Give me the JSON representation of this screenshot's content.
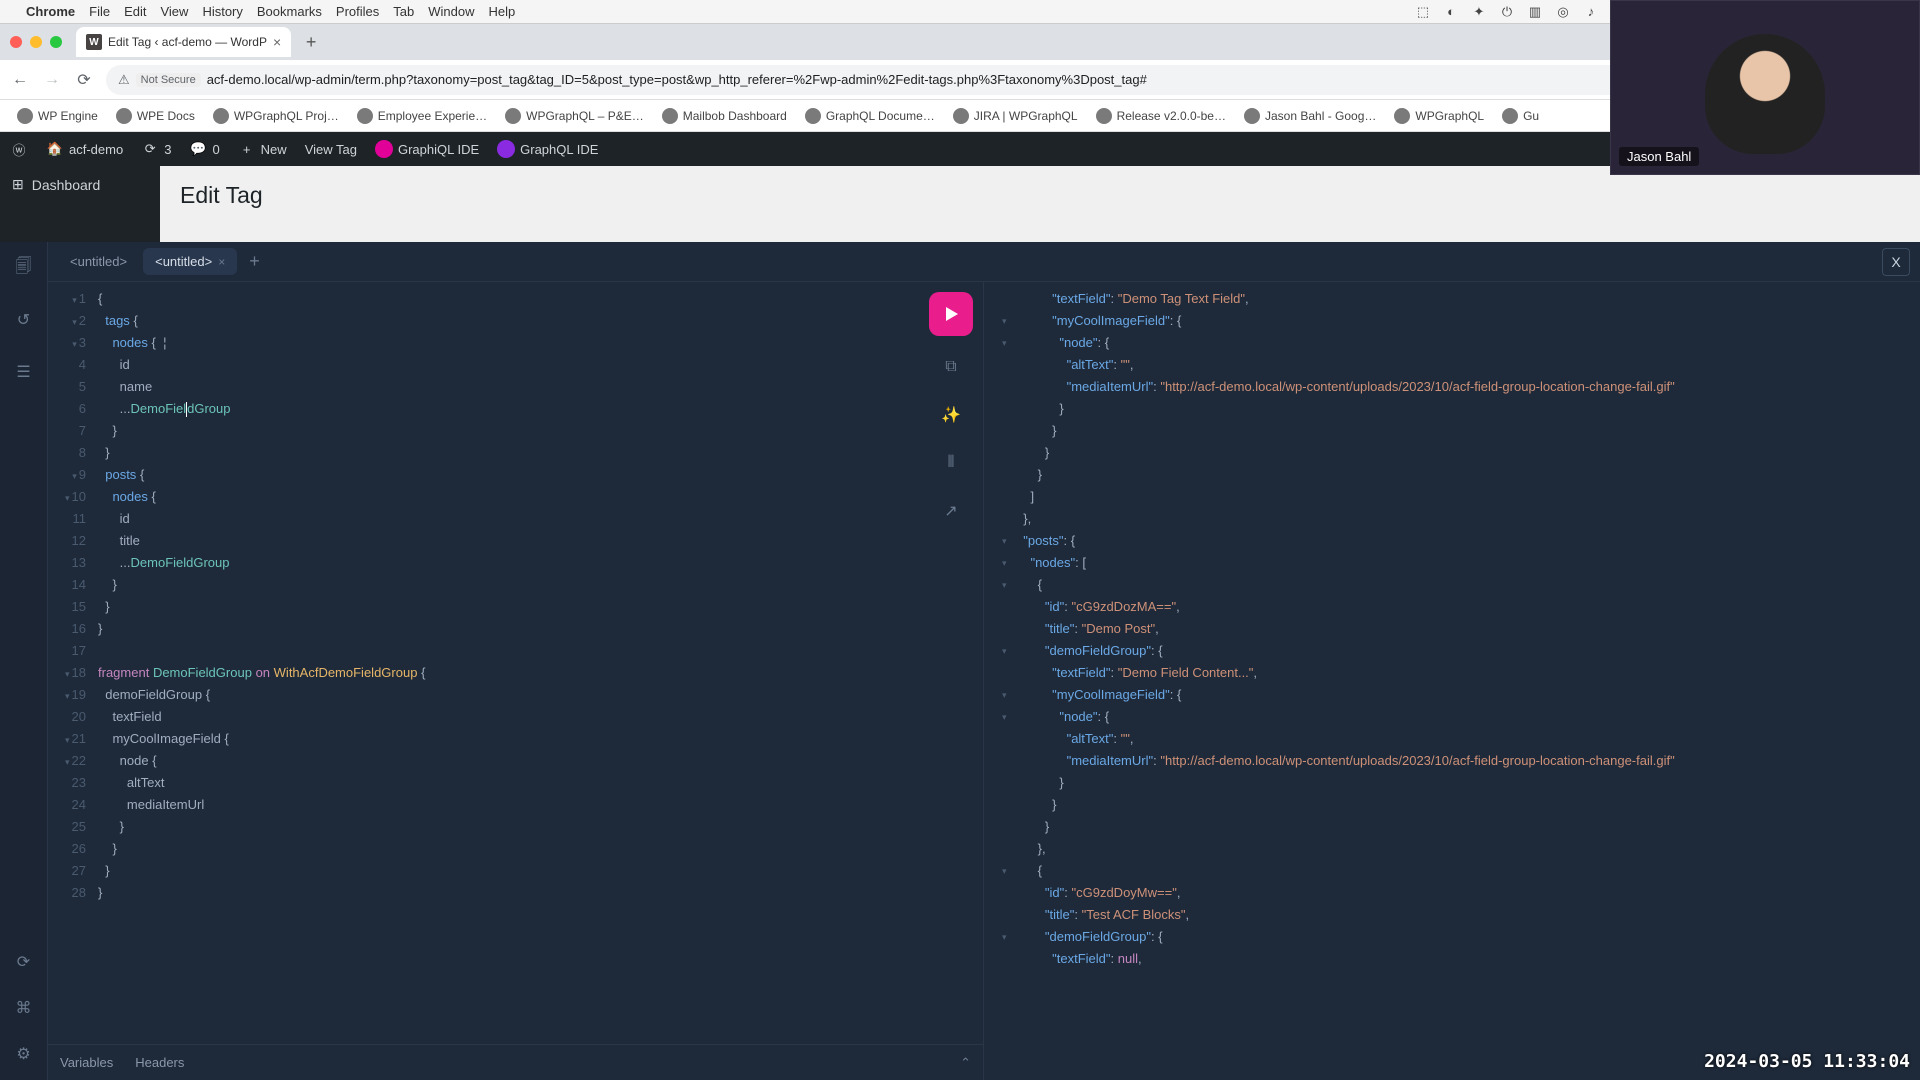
{
  "mac": {
    "app": "Chrome",
    "menus": [
      "File",
      "Edit",
      "View",
      "History",
      "Bookmarks",
      "Profiles",
      "Tab",
      "Window",
      "Help"
    ]
  },
  "chrome": {
    "tab_title": "Edit Tag ‹ acf-demo — WordP",
    "secure_label": "Not Secure",
    "url": "acf-demo.local/wp-admin/term.php?taxonomy=post_tag&tag_ID=5&post_type=post&wp_http_referer=%2Fwp-admin%2Fedit-tags.php%3Ftaxonomy%3Dpost_tag#",
    "bookmarks": [
      "WP Engine",
      "WPE Docs",
      "WPGraphQL Proj…",
      "Employee Experie…",
      "WPGraphQL – P&E…",
      "Mailbob Dashboard",
      "GraphQL Docume…",
      "JIRA | WPGraphQL",
      "Release v2.0.0-be…",
      "Jason Bahl - Goog…",
      "WPGraphQL",
      "Gu"
    ]
  },
  "wp": {
    "site": "acf-demo",
    "updates": "3",
    "comments": "0",
    "new": "New",
    "view": "View Tag",
    "gql1": "GraphiQL IDE",
    "gql2": "GraphQL IDE",
    "sidebar": {
      "dashboard": "Dashboard"
    },
    "page_title": "Edit Tag"
  },
  "ide": {
    "tabs": [
      "<untitled>",
      "<untitled>"
    ],
    "close_x": "X",
    "bottom": {
      "variables": "Variables",
      "headers": "Headers"
    }
  },
  "query_lines": [
    {
      "n": "1",
      "fold": "▾",
      "html": "<span class='tok-punct'>{</span>"
    },
    {
      "n": "2",
      "fold": "▾",
      "html": "  <span class='tok-key'>tags</span> <span class='tok-punct'>{</span>"
    },
    {
      "n": "3",
      "fold": "▾",
      "html": "    <span class='tok-key'>nodes</span> <span class='tok-punct'>{</span>  <span class='tok-field'>¦</span>"
    },
    {
      "n": "4",
      "fold": "",
      "html": "      <span class='tok-field'>id</span>"
    },
    {
      "n": "5",
      "fold": "",
      "html": "      <span class='tok-field'>name</span>"
    },
    {
      "n": "6",
      "fold": "",
      "html": "      <span class='tok-punct'>...</span><span class='tok-fragref'>DemoFiel</span><span class='cursor-bar'></span><span class='tok-fragref'>dGroup</span>"
    },
    {
      "n": "7",
      "fold": "",
      "html": "    <span class='tok-punct'>}</span>"
    },
    {
      "n": "8",
      "fold": "",
      "html": "  <span class='tok-punct'>}</span>"
    },
    {
      "n": "9",
      "fold": "▾",
      "html": "  <span class='tok-key'>posts</span> <span class='tok-punct'>{</span>"
    },
    {
      "n": "10",
      "fold": "▾",
      "html": "    <span class='tok-key'>nodes</span> <span class='tok-punct'>{</span>"
    },
    {
      "n": "11",
      "fold": "",
      "html": "      <span class='tok-field'>id</span>"
    },
    {
      "n": "12",
      "fold": "",
      "html": "      <span class='tok-field'>title</span>"
    },
    {
      "n": "13",
      "fold": "",
      "html": "      <span class='tok-punct'>...</span><span class='tok-fragref'>DemoFieldGroup</span>"
    },
    {
      "n": "14",
      "fold": "",
      "html": "    <span class='tok-punct'>}</span>"
    },
    {
      "n": "15",
      "fold": "",
      "html": "  <span class='tok-punct'>}</span>"
    },
    {
      "n": "16",
      "fold": "",
      "html": "<span class='tok-punct'>}</span>"
    },
    {
      "n": "17",
      "fold": "",
      "html": ""
    },
    {
      "n": "18",
      "fold": "▾",
      "html": "<span class='tok-kw'>fragment</span> <span class='tok-fragref'>DemoFieldGroup</span> <span class='tok-on'>on</span> <span class='tok-type'>WithAcfDemoFieldGroup</span> <span class='tok-punct'>{</span>"
    },
    {
      "n": "19",
      "fold": "▾",
      "html": "  <span class='tok-field'>demoFieldGroup</span> <span class='tok-punct'>{</span>"
    },
    {
      "n": "20",
      "fold": "",
      "html": "    <span class='tok-field'>textField</span>"
    },
    {
      "n": "21",
      "fold": "▾",
      "html": "    <span class='tok-field'>myCoolImageField</span> <span class='tok-punct'>{</span>"
    },
    {
      "n": "22",
      "fold": "▾",
      "html": "      <span class='tok-field'>node</span> <span class='tok-punct'>{</span>"
    },
    {
      "n": "23",
      "fold": "",
      "html": "        <span class='tok-field'>altText</span>"
    },
    {
      "n": "24",
      "fold": "",
      "html": "        <span class='tok-field'>mediaItemUrl</span>"
    },
    {
      "n": "25",
      "fold": "",
      "html": "      <span class='tok-punct'>}</span>"
    },
    {
      "n": "26",
      "fold": "",
      "html": "    <span class='tok-punct'>}</span>"
    },
    {
      "n": "27",
      "fold": "",
      "html": "  <span class='tok-punct'>}</span>"
    },
    {
      "n": "28",
      "fold": "",
      "html": "<span class='tok-punct'>}</span>"
    }
  ],
  "result_lines": [
    {
      "fold": "",
      "html": "          <span class='jkey'>\"textField\"</span><span class='jpunct'>: </span><span class='jstr'>\"Demo Tag Text Field\"</span><span class='jpunct'>,</span>"
    },
    {
      "fold": "▾",
      "html": "          <span class='jkey'>\"myCoolImageField\"</span><span class='jpunct'>: {</span>"
    },
    {
      "fold": "▾",
      "html": "            <span class='jkey'>\"node\"</span><span class='jpunct'>: {</span>"
    },
    {
      "fold": "",
      "html": "              <span class='jkey'>\"altText\"</span><span class='jpunct'>: </span><span class='jstr'>\"\"</span><span class='jpunct'>,</span>"
    },
    {
      "fold": "",
      "html": "              <span class='jkey'>\"mediaItemUrl\"</span><span class='jpunct'>: </span><span class='jstr'>\"http://acf-demo.local/wp-content/uploads/2023/10/acf-field-group-location-change-fail.gif\"</span>"
    },
    {
      "fold": "",
      "html": "            <span class='jpunct'>}</span>"
    },
    {
      "fold": "",
      "html": "          <span class='jpunct'>}</span>"
    },
    {
      "fold": "",
      "html": "        <span class='jpunct'>}</span>"
    },
    {
      "fold": "",
      "html": "      <span class='jpunct'>}</span>"
    },
    {
      "fold": "",
      "html": "    <span class='jpunct'>]</span>"
    },
    {
      "fold": "",
      "html": "  <span class='jpunct'>},</span>"
    },
    {
      "fold": "▾",
      "html": "  <span class='jkey'>\"posts\"</span><span class='jpunct'>: {</span>"
    },
    {
      "fold": "▾",
      "html": "    <span class='jkey'>\"nodes\"</span><span class='jpunct'>: [</span>"
    },
    {
      "fold": "▾",
      "html": "      <span class='jpunct'>{</span>"
    },
    {
      "fold": "",
      "html": "        <span class='jkey'>\"id\"</span><span class='jpunct'>: </span><span class='jstr'>\"cG9zdDozMA==\"</span><span class='jpunct'>,</span>"
    },
    {
      "fold": "",
      "html": "        <span class='jkey'>\"title\"</span><span class='jpunct'>: </span><span class='jstr'>\"Demo Post\"</span><span class='jpunct'>,</span>"
    },
    {
      "fold": "▾",
      "html": "        <span class='jkey'>\"demoFieldGroup\"</span><span class='jpunct'>: {</span>"
    },
    {
      "fold": "",
      "html": "          <span class='jkey'>\"textField\"</span><span class='jpunct'>: </span><span class='jstr'>\"Demo Field Content...\"</span><span class='jpunct'>,</span>"
    },
    {
      "fold": "▾",
      "html": "          <span class='jkey'>\"myCoolImageField\"</span><span class='jpunct'>: {</span>"
    },
    {
      "fold": "▾",
      "html": "            <span class='jkey'>\"node\"</span><span class='jpunct'>: {</span>"
    },
    {
      "fold": "",
      "html": "              <span class='jkey'>\"altText\"</span><span class='jpunct'>: </span><span class='jstr'>\"\"</span><span class='jpunct'>,</span>"
    },
    {
      "fold": "",
      "html": "              <span class='jkey'>\"mediaItemUrl\"</span><span class='jpunct'>: </span><span class='jstr'>\"http://acf-demo.local/wp-content/uploads/2023/10/acf-field-group-location-change-fail.gif\"</span>"
    },
    {
      "fold": "",
      "html": "            <span class='jpunct'>}</span>"
    },
    {
      "fold": "",
      "html": "          <span class='jpunct'>}</span>"
    },
    {
      "fold": "",
      "html": "        <span class='jpunct'>}</span>"
    },
    {
      "fold": "",
      "html": "      <span class='jpunct'>},</span>"
    },
    {
      "fold": "▾",
      "html": "      <span class='jpunct'>{</span>"
    },
    {
      "fold": "",
      "html": "        <span class='jkey'>\"id\"</span><span class='jpunct'>: </span><span class='jstr'>\"cG9zdDoyMw==\"</span><span class='jpunct'>,</span>"
    },
    {
      "fold": "",
      "html": "        <span class='jkey'>\"title\"</span><span class='jpunct'>: </span><span class='jstr'>\"Test ACF Blocks\"</span><span class='jpunct'>,</span>"
    },
    {
      "fold": "▾",
      "html": "        <span class='jkey'>\"demoFieldGroup\"</span><span class='jpunct'>: {</span>"
    },
    {
      "fold": "",
      "html": "          <span class='jkey'>\"textField\"</span><span class='jpunct'>: </span><span class='jnull'>null</span><span class='jpunct'>,</span>"
    }
  ],
  "webcam": {
    "name": "Jason Bahl"
  },
  "timestamp": "2024-03-05 11:33:04"
}
